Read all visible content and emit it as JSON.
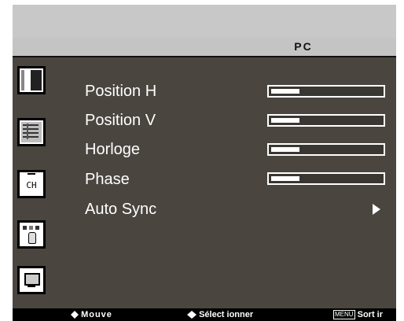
{
  "osd": {
    "title": "PC",
    "sidebar_icons": [
      "picture-icon",
      "image-settings-icon",
      "tv-channel-icon",
      "setup-hand-icon",
      "pc-monitor-icon"
    ],
    "items": [
      {
        "label": "Position H",
        "level": 0.25
      },
      {
        "label": "Position V",
        "level": 0.25
      },
      {
        "label": "Horloge",
        "level": 0.25
      },
      {
        "label": "Phase",
        "level": 0.25
      },
      {
        "label": "Auto Sync",
        "arrow": true
      }
    ],
    "channel_label": "CH",
    "footer": {
      "move": "Mouve",
      "select": "Sélect ionner",
      "menu_key": "MENU",
      "exit": "Sort ir"
    }
  }
}
